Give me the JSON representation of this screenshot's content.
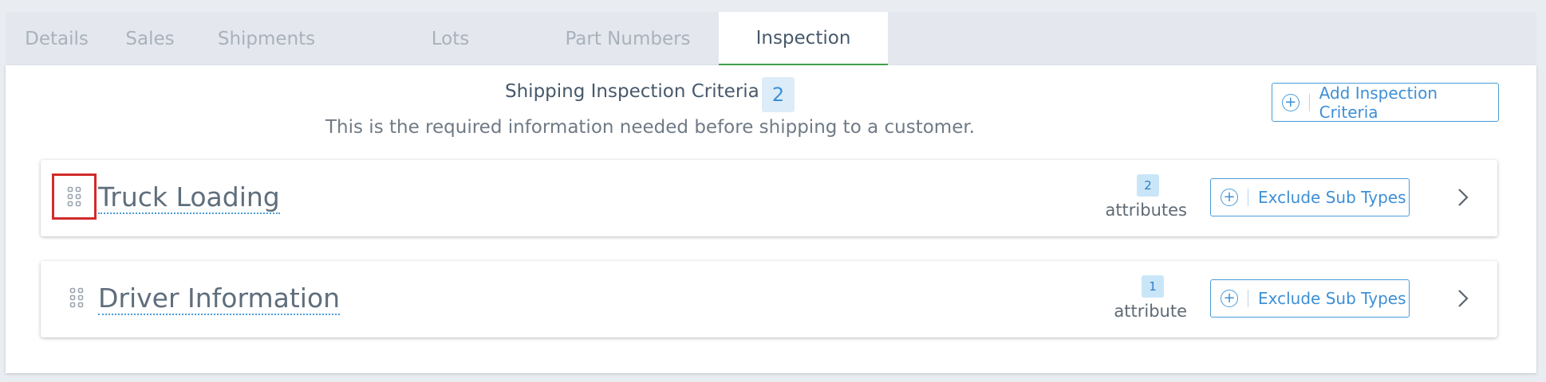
{
  "tabs": [
    {
      "label": "Details"
    },
    {
      "label": "Sales"
    },
    {
      "label": "Shipments"
    },
    {
      "label": "Lots"
    },
    {
      "label": "Part Numbers"
    },
    {
      "label": "Inspection"
    }
  ],
  "active_tab": "Inspection",
  "header": {
    "title": "Shipping Inspection Criteria",
    "count": "2",
    "description": "This is the required information needed before shipping to a customer.",
    "add_button_label": "Add Inspection Criteria"
  },
  "criteria": [
    {
      "title": "Truck Loading",
      "attr_count": "2",
      "attr_label": "attributes",
      "exclude_label": "Exclude Sub Types"
    },
    {
      "title": "Driver Information",
      "attr_count": "1",
      "attr_label": "attribute",
      "exclude_label": "Exclude Sub Types"
    }
  ],
  "colors": {
    "accent": "#3d8fd6",
    "active_tab_underline": "#3fa34d",
    "highlight": "#d22a2a"
  },
  "icons": {
    "add": "plus-circle-icon",
    "drag": "drag-handle-icon",
    "expand": "chevron-right-icon"
  }
}
